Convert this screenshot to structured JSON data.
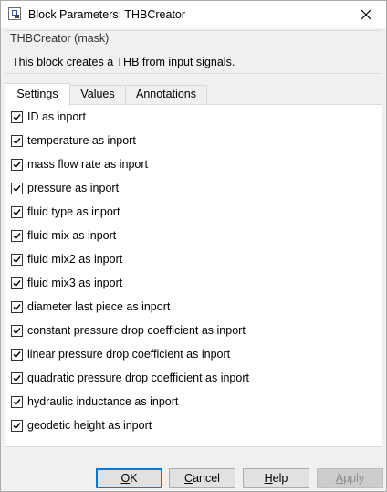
{
  "window": {
    "title": "Block Parameters: THBCreator"
  },
  "mask": {
    "group_title": "THBCreator (mask)",
    "description": "This block creates a THB from input signals."
  },
  "tabs": [
    {
      "label": "Settings",
      "active": true
    },
    {
      "label": "Values",
      "active": false
    },
    {
      "label": "Annotations",
      "active": false
    }
  ],
  "settings": {
    "checkboxes": [
      {
        "label": "ID as inport",
        "checked": true
      },
      {
        "label": "temperature as inport",
        "checked": true
      },
      {
        "label": "mass flow rate as inport",
        "checked": true
      },
      {
        "label": "pressure as inport",
        "checked": true
      },
      {
        "label": "fluid type as inport",
        "checked": true
      },
      {
        "label": "fluid mix as inport",
        "checked": true
      },
      {
        "label": "fluid mix2 as inport",
        "checked": true
      },
      {
        "label": "fluid mix3 as inport",
        "checked": true
      },
      {
        "label": "diameter last piece as inport",
        "checked": true
      },
      {
        "label": "constant pressure drop coefficient as inport",
        "checked": true
      },
      {
        "label": "linear pressure drop coefficient as inport",
        "checked": true
      },
      {
        "label": "quadratic pressure drop coefficient as inport",
        "checked": true
      },
      {
        "label": "hydraulic inductance as inport",
        "checked": true
      },
      {
        "label": "geodetic height as inport",
        "checked": true
      }
    ]
  },
  "buttons": {
    "ok": {
      "mnemonic": "O",
      "rest": "K"
    },
    "cancel": {
      "mnemonic": "C",
      "rest": "ancel"
    },
    "help": {
      "mnemonic": "H",
      "rest": "elp"
    },
    "apply": {
      "mnemonic": "A",
      "rest": "pply",
      "enabled": false
    }
  },
  "icons": {
    "app": "block-parameters-icon",
    "close": "close-icon",
    "check": "checkmark-icon"
  }
}
